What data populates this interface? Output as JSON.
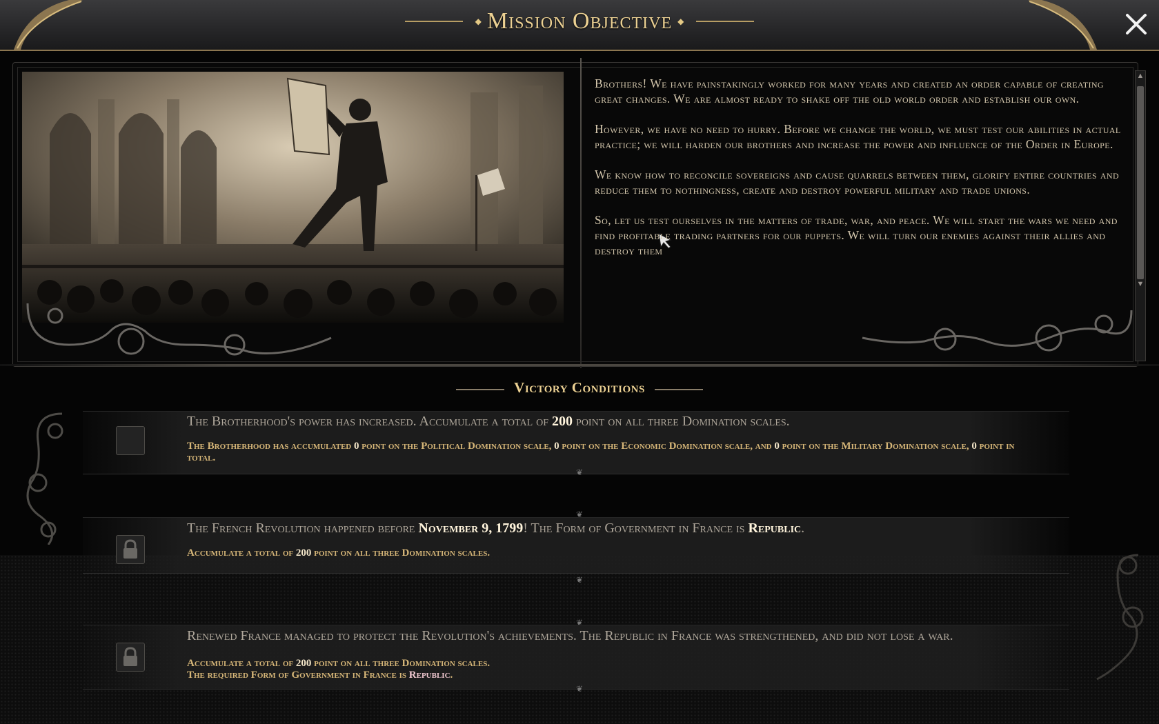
{
  "header": {
    "title": "Mission Objective",
    "close_icon": "close-icon"
  },
  "story": {
    "paragraphs": [
      "Brothers! We have painstakingly worked for many years and created an order capable of creating great changes. We are almost ready to shake off the old world order and establish our own.",
      "However, we have no need to hurry. Before we change the world, we must test our abilities in actual practice; we will harden our brothers and increase the power and influence of the Order in Europe.",
      "We know how to reconcile sovereigns and cause quarrels between them, glorify entire countries and reduce them to nothingness, create and destroy powerful military and trade unions.",
      "So, let us test ourselves in the matters of trade, war, and peace. We will start the wars we need and find profitable trading partners for our puppets. We will turn our enemies against their allies and destroy them"
    ]
  },
  "victory": {
    "title": "Victory Conditions",
    "conditions": [
      {
        "main_a": "The Brotherhood's power has increased. Accumulate a total of ",
        "main_hl": "200",
        "main_b": " point on all three Domination scales.",
        "sub": {
          "t1": "The Brotherhood has accumulated ",
          "v1": "0",
          "t2": " point on the Political Domination scale, ",
          "v2": "0",
          "t3": " point on the Economic Domination scale, and ",
          "v3": "0",
          "t4": " point on the Military Domination scale, ",
          "v4": "0",
          "t5": " point in total."
        },
        "state": "unchecked"
      },
      {
        "main_a": "The French Revolution happened before ",
        "main_hl1": "November 9, 1799",
        "main_b": "! The Form of Government in France is ",
        "main_hl2": "Republic",
        "main_c": ".",
        "sub_a": "Accumulate a total of ",
        "sub_v": "200",
        "sub_b": " point on all three Domination scales.",
        "state": "locked"
      },
      {
        "main": "Renewed France managed to protect the Revolution's achievements. The Republic in France was strengthened, and did not lose a war.",
        "sub1_a": "Accumulate a total of ",
        "sub1_v": "200",
        "sub1_b": " point on all three Domination scales.",
        "sub2_a": "The required Form of Government in France is ",
        "sub2_v": "Republic",
        "sub2_b": ".",
        "state": "locked"
      }
    ]
  },
  "icons": {
    "lock": "lock-icon",
    "checkbox": "checkbox-icon",
    "ornament": "ornament-icon"
  },
  "colors": {
    "gold_title": "#ecd193",
    "condition_sub": "#d6b678",
    "background": "#050505"
  }
}
